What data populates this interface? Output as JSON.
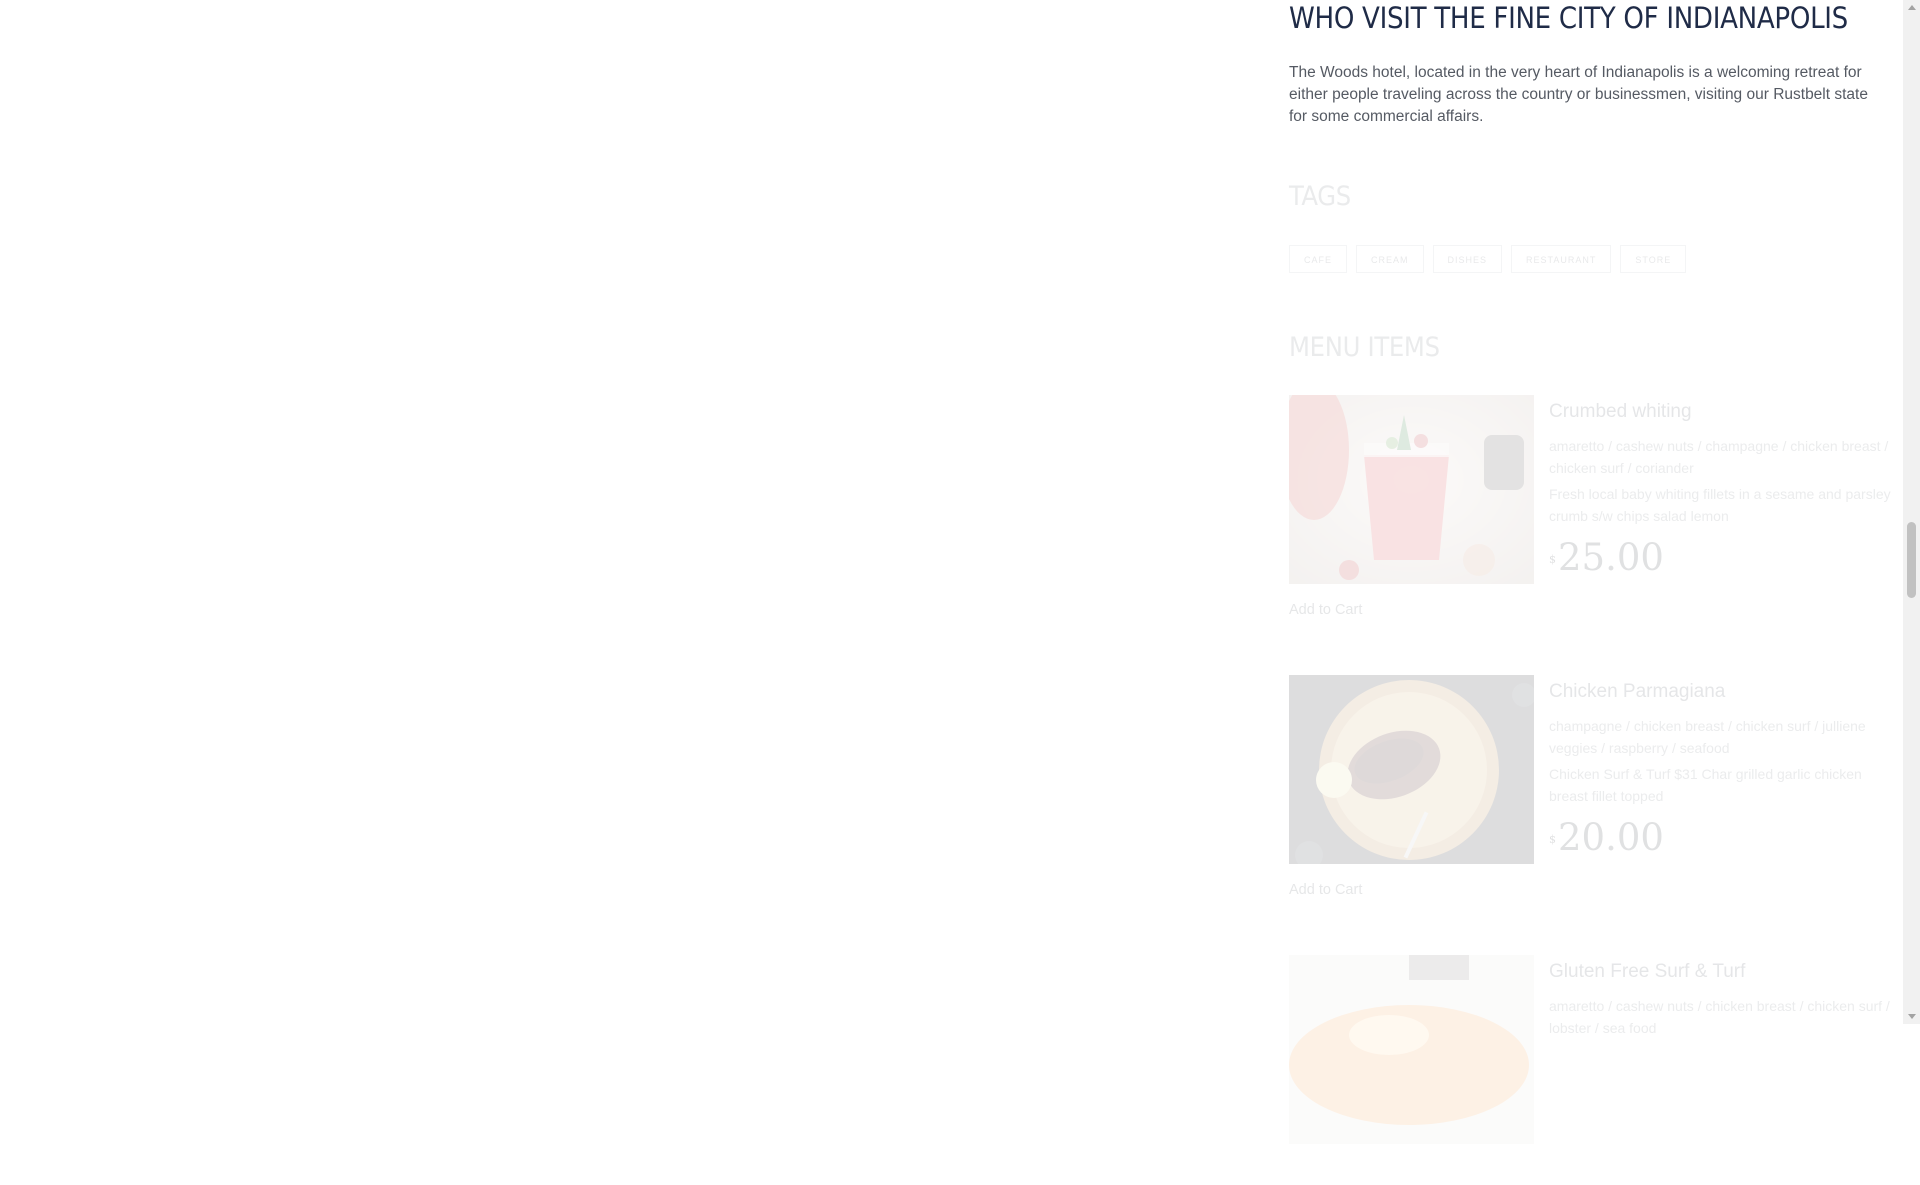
{
  "about": {
    "title": "WHO VISIT THE FINE CITY OF INDIANAPOLIS",
    "text": "The Woods hotel, located in the very heart of Indianapolis is a welcoming retreat for either people traveling across the country or businessmen, visiting our Rustbelt state for some commercial affairs."
  },
  "tags": {
    "title": "TAGS",
    "items": [
      "CAFE",
      "CREAM",
      "DISHES",
      "RESTAURANT",
      "STORE"
    ]
  },
  "menu": {
    "title": "MENU ITEMS",
    "items": [
      {
        "name": "Crumbed whiting",
        "ingredients": "amaretto / cashew nuts / champagne / chicken breast / chicken surf / coriander",
        "description": "Fresh local baby whiting fillets in a sesame and parsley crumb s/w chips salad lemon",
        "currency": "$",
        "price": "25.00",
        "add_to_cart": "Add to Cart",
        "image": "cocktail-photo"
      },
      {
        "name": "Chicken Parmagiana",
        "ingredients": "champagne / chicken breast / chicken surf / julliene veggies / raspberry / seafood",
        "description": "Chicken Surf & Turf $31 Char grilled garlic chicken breast fillet topped",
        "currency": "$",
        "price": "20.00",
        "add_to_cart": "Add to Cart",
        "image": "grilled-meat-photo"
      },
      {
        "name": "Gluten Free Surf & Turf",
        "ingredients": "amaretto / cashew nuts / chicken breast / chicken surf / lobster / sea food",
        "image": "food-photo"
      }
    ]
  },
  "colors": {
    "heading": "#1f2b47",
    "body_text": "#555a63",
    "page_background": "#ffffff"
  }
}
